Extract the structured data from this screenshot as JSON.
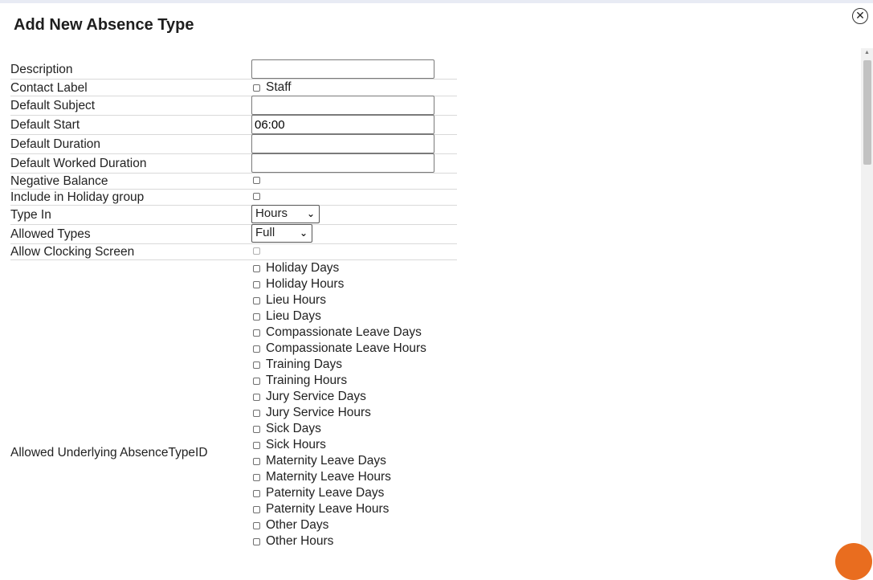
{
  "modal": {
    "title": "Add New Absence Type",
    "close_icon": "close-icon"
  },
  "fields": {
    "description": {
      "label": "Description",
      "value": ""
    },
    "contact_label": {
      "label": "Contact Label",
      "option": "Staff",
      "checked": false
    },
    "default_subject": {
      "label": "Default Subject",
      "value": ""
    },
    "default_start": {
      "label": "Default Start",
      "value": "06:00"
    },
    "default_duration": {
      "label": "Default Duration",
      "value": ""
    },
    "default_worked_duration": {
      "label": "Default Worked Duration",
      "value": ""
    },
    "negative_balance": {
      "label": "Negative Balance",
      "checked": false
    },
    "include_in_holiday_group": {
      "label": "Include in Holiday group",
      "checked": false
    },
    "type_in": {
      "label": "Type In",
      "selected": "Hours"
    },
    "allowed_types": {
      "label": "Allowed Types",
      "selected": "Full"
    },
    "allow_clocking_screen": {
      "label": "Allow Clocking Screen",
      "checked": false
    },
    "allowed_underlying": {
      "label": "Allowed Underlying AbsenceTypeID",
      "options": [
        "Holiday Days",
        "Holiday Hours",
        "Lieu Hours",
        "Lieu Days",
        "Compassionate Leave Days",
        "Compassionate Leave Hours",
        "Training Days",
        "Training Hours",
        "Jury Service Days",
        "Jury Service Hours",
        "Sick Days",
        "Sick Hours",
        "Maternity Leave Days",
        "Maternity Leave Hours",
        "Paternity Leave Days",
        "Paternity Leave Hours",
        "Other Days",
        "Other Hours"
      ]
    }
  },
  "colors": {
    "accent_fab": "#e96d1f",
    "row_border": "#d9d9d9"
  }
}
